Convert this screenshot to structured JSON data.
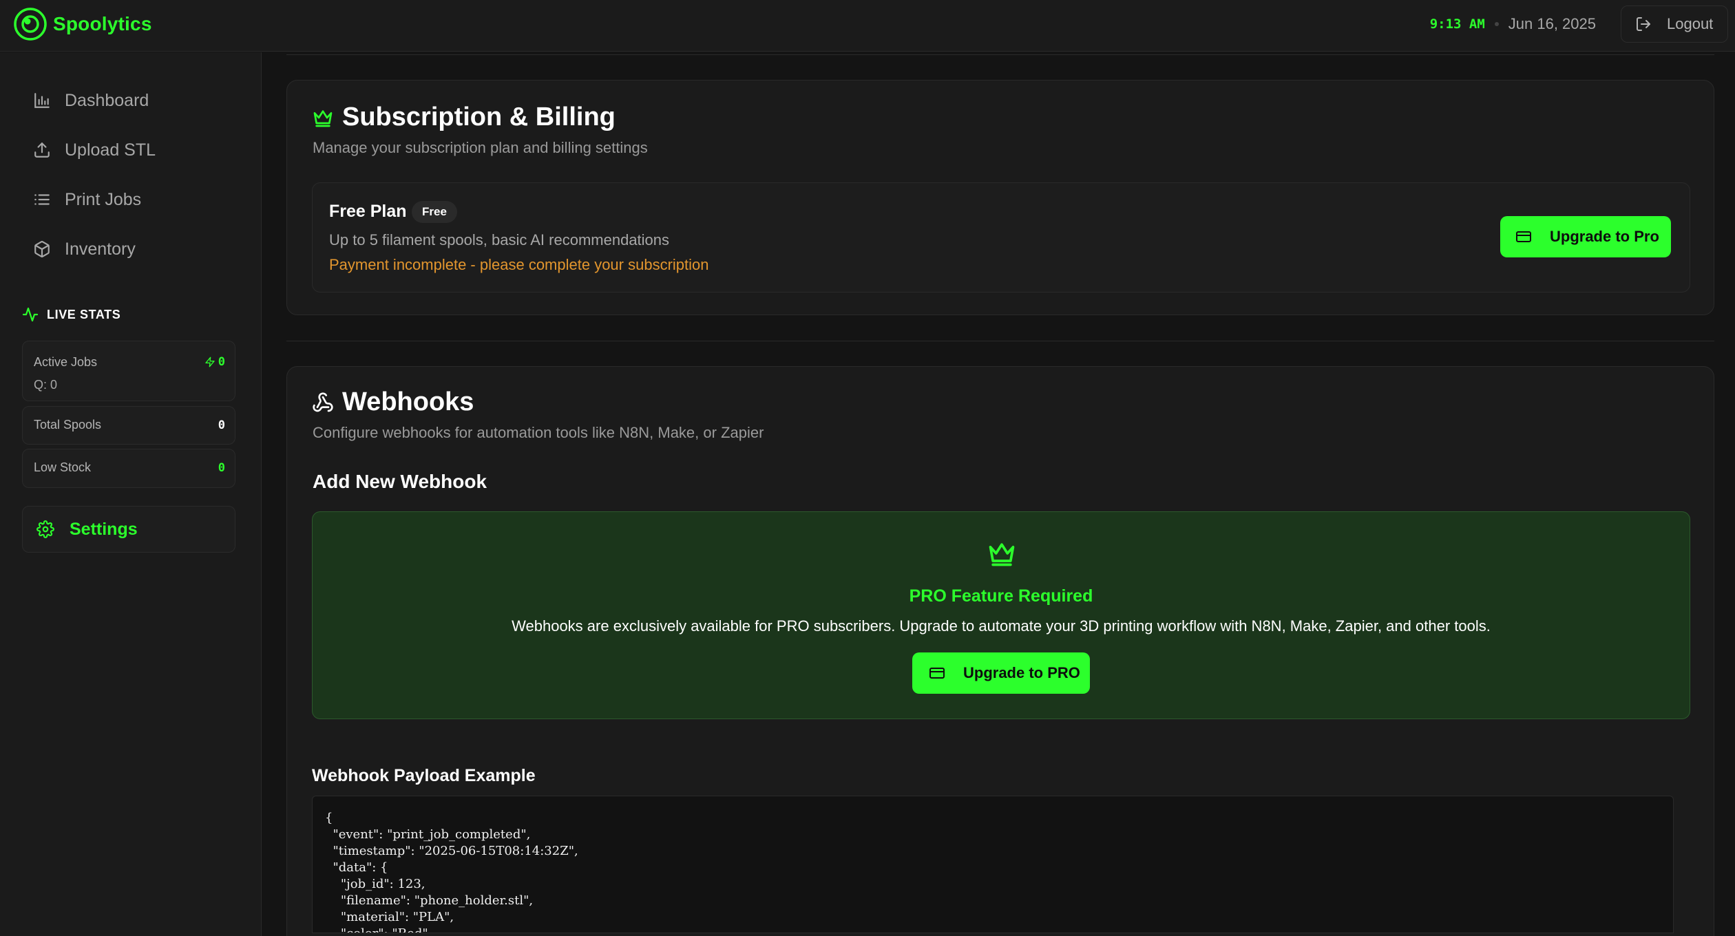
{
  "header": {
    "brand_name": "Spoolytics",
    "time": "9:13 AM",
    "date": "Jun 16, 2025",
    "logout_label": "Logout"
  },
  "sidebar": {
    "nav": [
      {
        "label": "Dashboard",
        "icon": "bar-chart-icon"
      },
      {
        "label": "Upload STL",
        "icon": "upload-icon"
      },
      {
        "label": "Print Jobs",
        "icon": "list-icon"
      },
      {
        "label": "Inventory",
        "icon": "box-icon"
      }
    ],
    "live_stats": {
      "heading": "LIVE STATS",
      "active_jobs_label": "Active Jobs",
      "active_jobs_value": "0",
      "queue_label": "Q: 0",
      "total_spools_label": "Total Spools",
      "total_spools_value": "0",
      "low_stock_label": "Low Stock",
      "low_stock_value": "0"
    },
    "settings_label": "Settings"
  },
  "billing": {
    "title": "Subscription & Billing",
    "description": "Manage your subscription plan and billing settings",
    "plan_name": "Free Plan",
    "plan_badge": "Free",
    "plan_description": "Up to 5 filament spools, basic AI recommendations",
    "warning": "Payment incomplete - please complete your subscription",
    "upgrade_label": "Upgrade to Pro"
  },
  "webhooks": {
    "title": "Webhooks",
    "description": "Configure webhooks for automation tools like N8N, Make, or Zapier",
    "add_heading": "Add New Webhook",
    "pro_title": "PRO Feature Required",
    "pro_description": "Webhooks are exclusively available for PRO subscribers. Upgrade to automate your 3D printing workflow with N8N, Make, Zapier, and other tools.",
    "pro_button_label": "Upgrade to PRO",
    "payload_title": "Webhook Payload Example",
    "payload_code": "{\n  \"event\": \"print_job_completed\",\n  \"timestamp\": \"2025-06-15T08:14:32Z\",\n  \"data\": {\n    \"job_id\": 123,\n    \"filename\": \"phone_holder.stl\",\n    \"material\": \"PLA\",\n    \"color\": \"Red\","
  },
  "colors": {
    "accent": "#2cff2c",
    "warning": "#e3962e",
    "background": "#141414",
    "panel": "#1b1b1b"
  }
}
